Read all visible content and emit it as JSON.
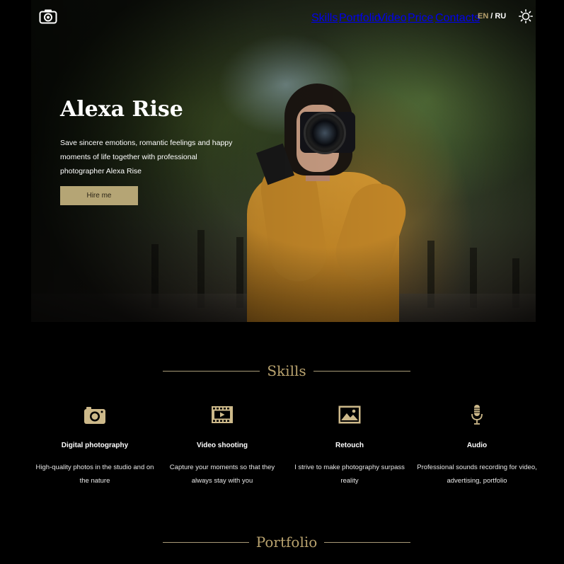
{
  "nav": {
    "items": [
      {
        "label": "Skills"
      },
      {
        "label": "Portfolio"
      },
      {
        "label": "Video"
      },
      {
        "label": "Price"
      },
      {
        "label": "Contacts"
      }
    ],
    "lang_en": "EN",
    "lang_sep": "/",
    "lang_ru": "RU"
  },
  "hero": {
    "title": "Alexa Rise",
    "description": "Save sincere emotions, romantic feelings and happy moments of life together with professional photographer Alexa Rise",
    "button_label": "Hire me"
  },
  "skills": {
    "heading": "Skills",
    "items": [
      {
        "icon": "camera-icon",
        "title": "Digital photography",
        "description": "High-quality photos in the studio and on the nature"
      },
      {
        "icon": "film-icon",
        "title": "Video shooting",
        "description": "Capture your moments so that they always stay with you"
      },
      {
        "icon": "image-icon",
        "title": "Retouch",
        "description": "I strive to make photography surpass reality"
      },
      {
        "icon": "microphone-icon",
        "title": "Audio",
        "description": "Professional sounds recording for video, advertising, portfolio"
      }
    ]
  },
  "portfolio": {
    "heading": "Portfolio"
  },
  "colors": {
    "accent": "#b8a26e",
    "button_bg": "#b5a575",
    "background": "#000000"
  }
}
